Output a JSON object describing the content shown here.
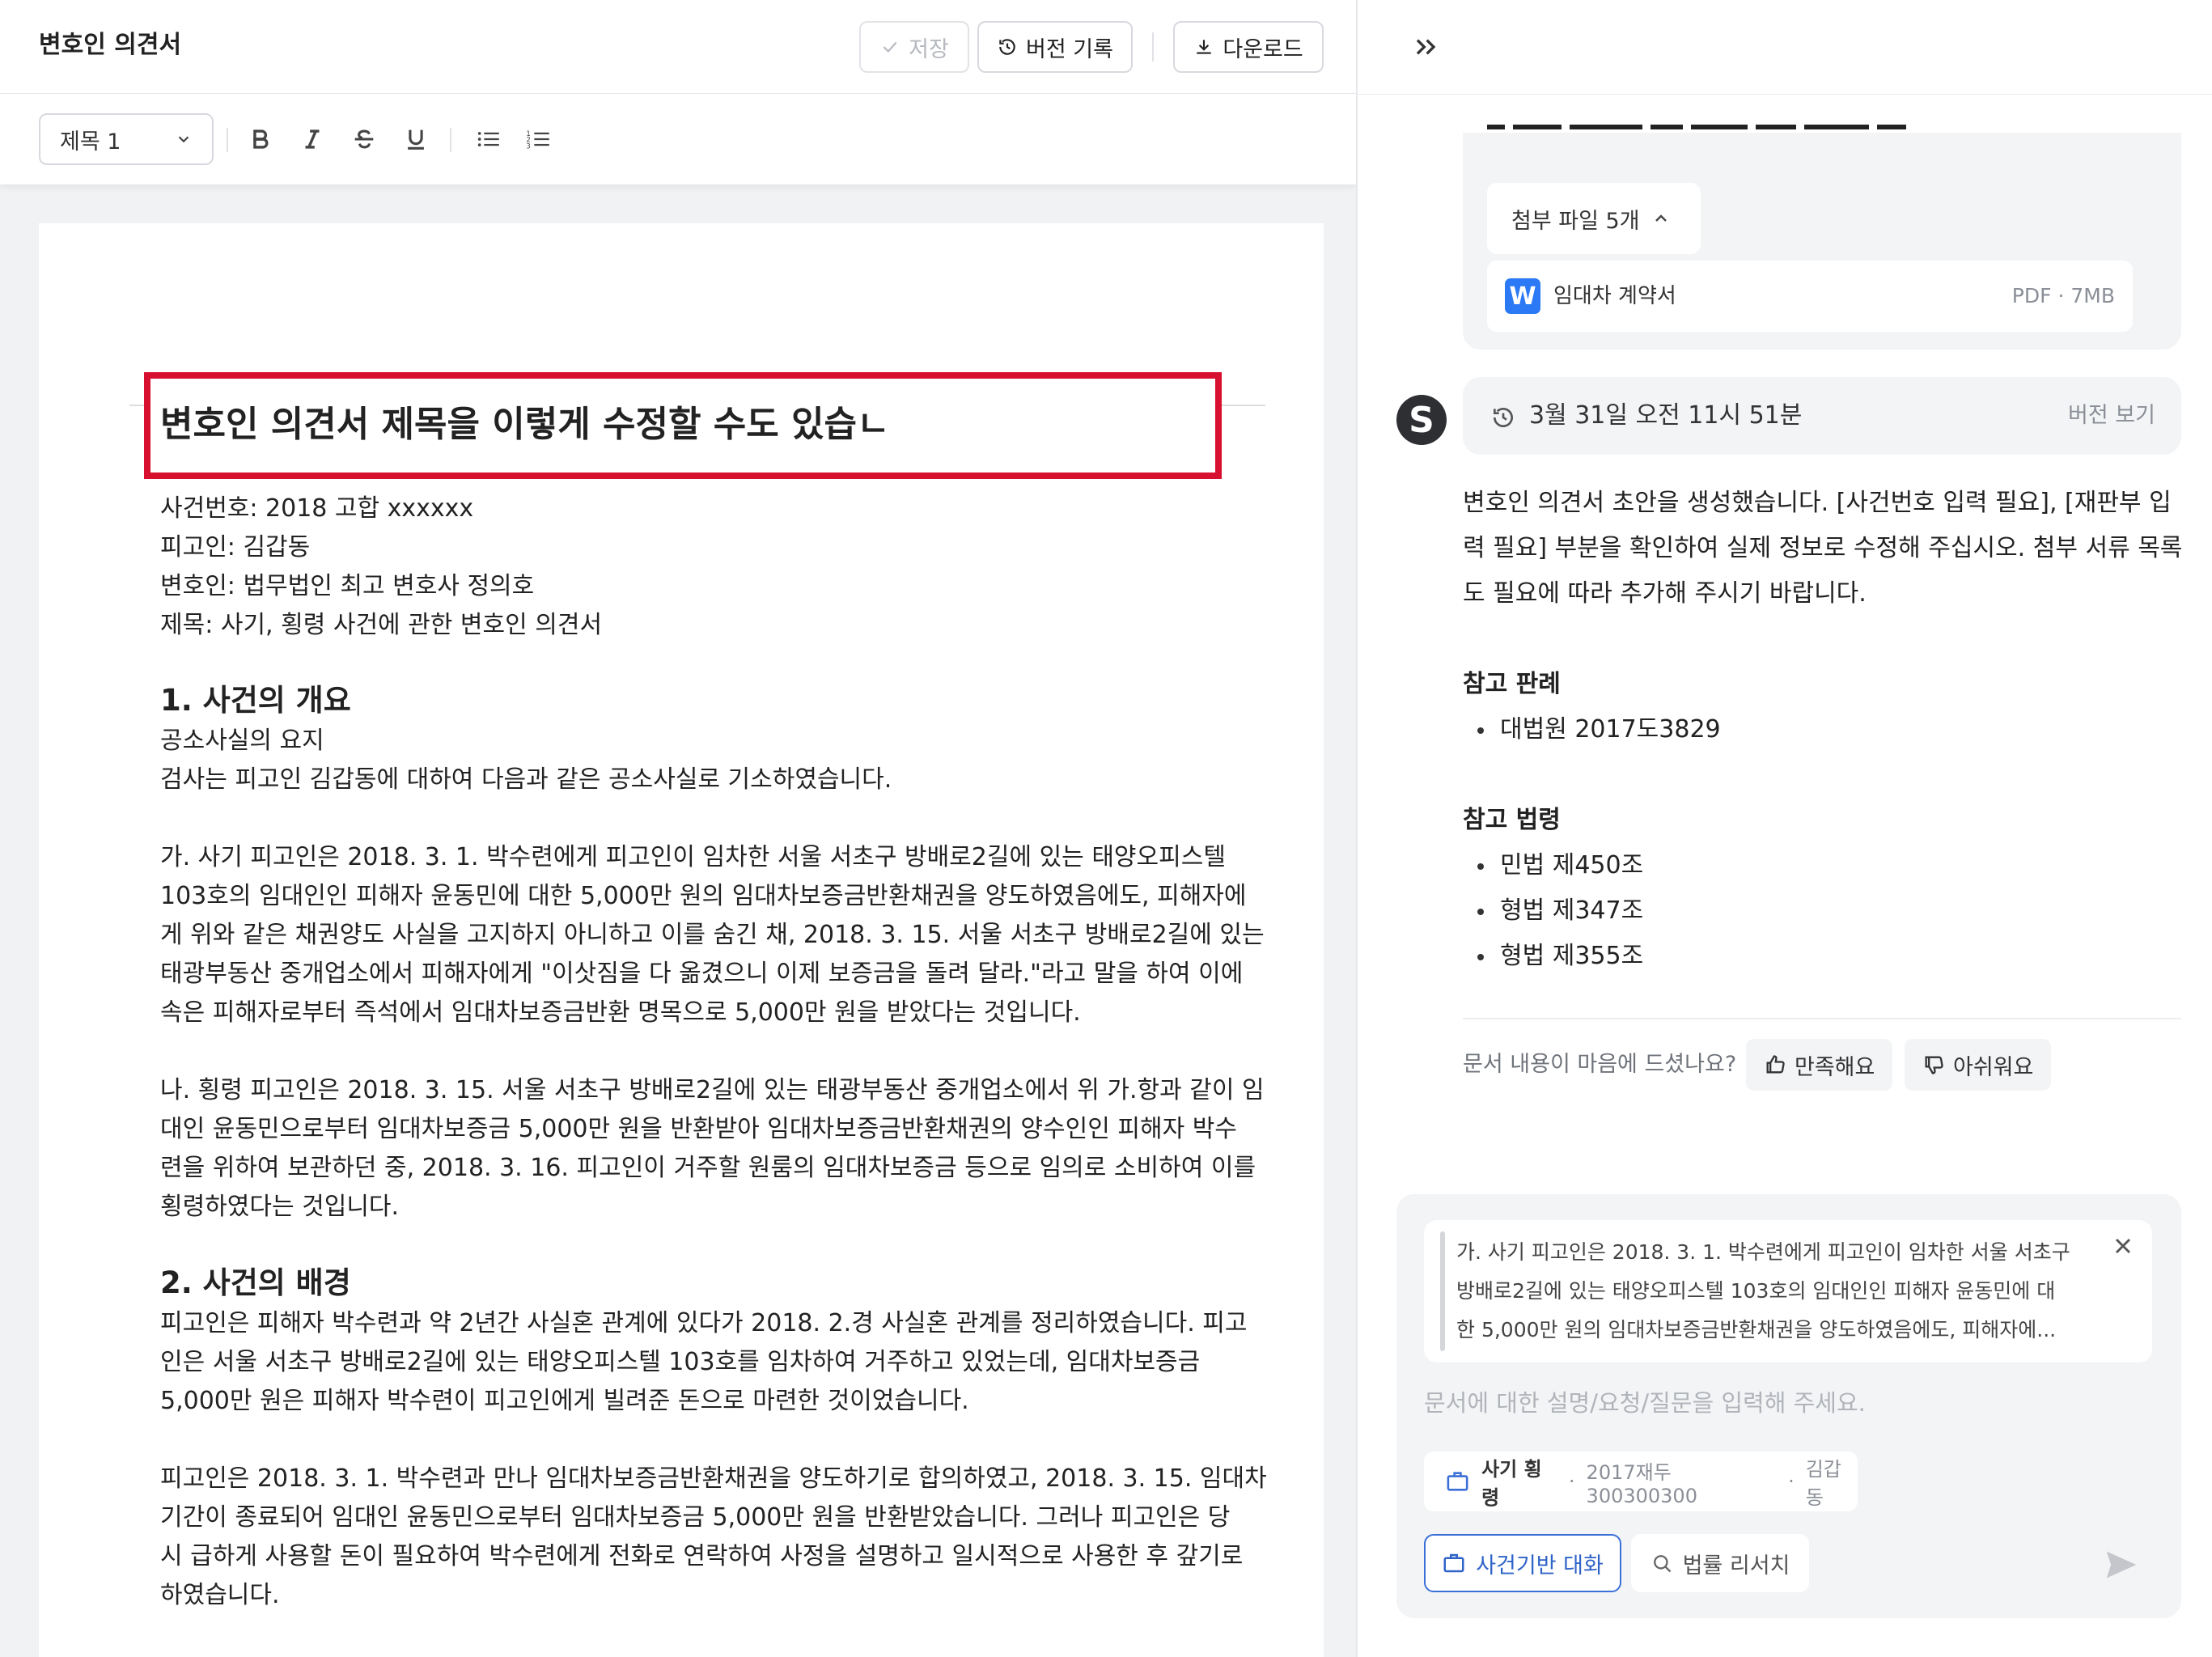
{
  "editor": {
    "doc_title": "변호인 의견서",
    "toolbar": {
      "save": "저장",
      "history": "버전 기록",
      "download": "다운로드"
    },
    "style_select": "제목 1",
    "heading": "변호인 의견서 제목을 이렇게 수정할 수도 있습ㄴ",
    "meta": [
      "사건번호: 2018 고합 xxxxxx",
      "피고인: 김갑동",
      "변호인: 법무법인 최고 변호사 정의호",
      "제목: 사기, 횡령 사건에 관한 변호인 의견서"
    ],
    "section1": {
      "title": "1. 사건의 개요",
      "lines": [
        "공소사실의 요지",
        "검사는 피고인 김갑동에 대하여 다음과 같은 공소사실로 기소하였습니다."
      ]
    },
    "para_ga": [
      "가. 사기 피고인은 2018. 3. 1. 박수련에게 피고인이 임차한 서울 서초구 방배로2길에 있는 태양오피스텔",
      "103호의 임대인인 피해자 윤동민에 대한 5,000만 원의 임대차보증금반환채권을 양도하였음에도, 피해자에",
      "게 위와 같은 채권양도 사실을 고지하지 아니하고 이를 숨긴 채, 2018. 3. 15. 서울 서초구 방배로2길에 있는",
      "태광부동산 중개업소에서 피해자에게 \"이삿짐을 다 옮겼으니 이제 보증금을 돌려 달라.\"라고 말을 하여 이에",
      "속은 피해자로부터 즉석에서 임대차보증금반환 명목으로 5,000만 원을 받았다는 것입니다."
    ],
    "para_na": [
      "나. 횡령 피고인은 2018. 3. 15. 서울 서초구 방배로2길에 있는 태광부동산 중개업소에서 위 가.항과 같이 임",
      "대인 윤동민으로부터 임대차보증금 5,000만 원을 반환받아 임대차보증금반환채권의 양수인인 피해자 박수",
      "련을 위하여 보관하던 중, 2018. 3. 16. 피고인이 거주할 원룸의 임대차보증금 등으로 임의로 소비하여 이를",
      "횡령하였다는 것입니다."
    ],
    "section2": {
      "title": "2. 사건의 배경"
    },
    "para_bg1": [
      "피고인은 피해자 박수련과 약 2년간 사실혼 관계에 있다가 2018. 2.경 사실혼 관계를 정리하였습니다. 피고",
      "인은 서울 서초구 방배로2길에 있는 태양오피스텔 103호를 임차하여 거주하고 있었는데, 임대차보증금",
      "5,000만 원은 피해자 박수련이 피고인에게 빌려준 돈으로 마련한 것이었습니다."
    ],
    "para_bg2": [
      "피고인은 2018. 3. 1. 박수련과 만나 임대차보증금반환채권을 양도하기로 합의하였고, 2018. 3. 15. 임대차",
      "기간이 종료되어 임대인 윤동민으로부터 임대차보증금 5,000만 원을 반환받았습니다. 그러나 피고인은 당",
      "시 급하게 사용할 돈이 필요하여 박수련에게 전화로 연락하여 사정을 설명하고 일시적으로 사용한 후 갚기로",
      "하였습니다."
    ]
  },
  "chat": {
    "attachments": {
      "toggle_label": "첨부 파일 5개",
      "item": {
        "name": "임대차 계약서",
        "type": "PDF",
        "size": "7MB",
        "icon_letter": "W"
      }
    },
    "message": {
      "avatar_letter": "S",
      "timestamp": "3월 31일 오전 11시 51분",
      "view_version": "버전 보기",
      "body": [
        "변호인 의견서 초안을 생성했습니다. [사건번호 입력 필요], [재판부 입",
        "력 필요] 부분을 확인하여 실제 정보로 수정해 주십시오. 첨부 서류 목록",
        "도 필요에 따라 추가해 주시기 바랍니다."
      ],
      "precedents_title": "참고 판례",
      "precedents": [
        "대법원 2017도3829"
      ],
      "laws_title": "참고 법령",
      "laws": [
        "민법 제450조",
        "형법 제347조",
        "형법 제355조"
      ]
    },
    "feedback": {
      "question": "문서 내용이 마음에 드셨나요?",
      "like": "만족해요",
      "dislike": "아쉬워요"
    },
    "composer": {
      "quote": [
        "가. 사기 피고인은 2018. 3. 1. 박수련에게 피고인이 임차한 서울 서초구",
        "방배로2길에 있는 태양오피스텔 103호의 임대인인 피해자 윤동민에 대",
        "한 5,000만 원의 임대차보증금반환채권을 양도하였음에도, 피해자에..."
      ],
      "placeholder": "문서에 대한 설명/요청/질문을 입력해 주세요.",
      "case_chip": {
        "name": "사기 횡령",
        "number": "2017재두300300300",
        "party": "김갑동"
      },
      "mode_case": "사건기반 대화",
      "mode_research": "법률 리서치"
    }
  },
  "colors": {
    "highlight_border": "#d8102f",
    "accent": "#3a6fd8",
    "word_blue": "#2b79f5"
  }
}
